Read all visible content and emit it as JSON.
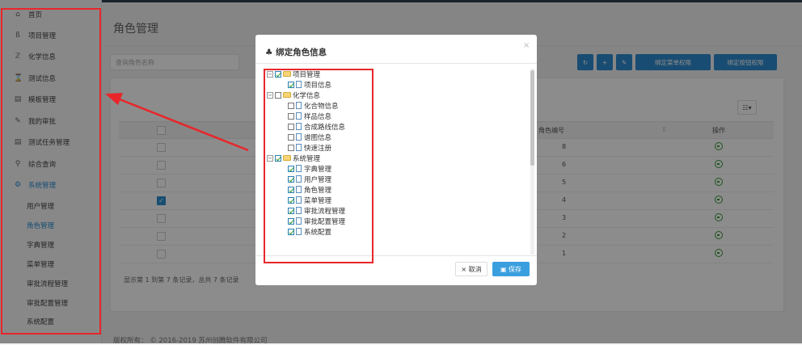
{
  "sidebar": {
    "items": [
      {
        "label": "首页",
        "icon": "home-icon",
        "glyph": "⌂"
      },
      {
        "label": "项目管理",
        "icon": "project-icon",
        "glyph": "ß"
      },
      {
        "label": "化学信息",
        "icon": "chemistry-icon",
        "glyph": "ℤ"
      },
      {
        "label": "测试信息",
        "icon": "hourglass-icon",
        "glyph": "⌛"
      },
      {
        "label": "模板管理",
        "icon": "template-icon",
        "glyph": "▤"
      },
      {
        "label": "我的审批",
        "icon": "edit-icon",
        "glyph": "✎"
      },
      {
        "label": "测试任务管理",
        "icon": "task-icon",
        "glyph": "▤"
      },
      {
        "label": "综合查询",
        "icon": "search-icon",
        "glyph": "⚲"
      },
      {
        "label": "系统管理",
        "icon": "gear-icon",
        "glyph": "⚙"
      }
    ],
    "sub_items": [
      {
        "label": "用户管理"
      },
      {
        "label": "角色管理"
      },
      {
        "label": "字典管理"
      },
      {
        "label": "菜单管理"
      },
      {
        "label": "审批流程管理"
      },
      {
        "label": "审批配置管理"
      },
      {
        "label": "系统配置"
      }
    ]
  },
  "page": {
    "title": "角色管理",
    "search_placeholder": "查询角色名称",
    "toolbar": {
      "refresh_glyph": "↻",
      "add_glyph": "+",
      "edit_glyph": "✎",
      "bind_menu_label": "绑定菜单权限",
      "bind_button_label": "绑定按钮权限",
      "columns_glyph": "☷▾"
    },
    "table": {
      "headers": {
        "role_no": "角色编号",
        "sort_glyph": "⇕",
        "operation": "操作"
      },
      "rows": [
        {
          "role_no": "8",
          "checked": false
        },
        {
          "role_no": "6",
          "checked": false
        },
        {
          "role_no": "5",
          "checked": false
        },
        {
          "role_no": "4",
          "checked": true
        },
        {
          "role_no": "3",
          "checked": false
        },
        {
          "role_no": "2",
          "checked": false
        },
        {
          "role_no": "1",
          "checked": false
        }
      ]
    },
    "pager_text": "显示第 1 到第 7 条记录，总共 7 条记录",
    "footer": "版权所有： © 2016-2019 苏州创腾软件有限公司"
  },
  "modal": {
    "title": "绑定角色信息",
    "title_glyph": "♣",
    "close_glyph": "×",
    "tree": [
      {
        "label": "项目管理",
        "level": 0,
        "checked": true
      },
      {
        "label": "项目信息",
        "level": 1,
        "checked": true
      },
      {
        "label": "化学信息",
        "level": 0,
        "checked": false
      },
      {
        "label": "化合物信息",
        "level": 1,
        "checked": false
      },
      {
        "label": "样品信息",
        "level": 1,
        "checked": false
      },
      {
        "label": "合成路线信息",
        "level": 1,
        "checked": false
      },
      {
        "label": "谱图信息",
        "level": 1,
        "checked": false
      },
      {
        "label": "快速注册",
        "level": 1,
        "checked": false
      },
      {
        "label": "系统管理",
        "level": 0,
        "checked": true
      },
      {
        "label": "字典管理",
        "level": 1,
        "checked": true
      },
      {
        "label": "用户管理",
        "level": 1,
        "checked": true
      },
      {
        "label": "角色管理",
        "level": 1,
        "checked": true
      },
      {
        "label": "菜单管理",
        "level": 1,
        "checked": true
      },
      {
        "label": "审批流程管理",
        "level": 1,
        "checked": true
      },
      {
        "label": "审批配置管理",
        "level": 1,
        "checked": true
      },
      {
        "label": "系统配置",
        "level": 1,
        "checked": true
      }
    ],
    "cancel_label": "× 取消",
    "save_label": "▣ 保存"
  },
  "colors": {
    "annotation": "#e8262a",
    "accent": "#2a8fcf"
  }
}
